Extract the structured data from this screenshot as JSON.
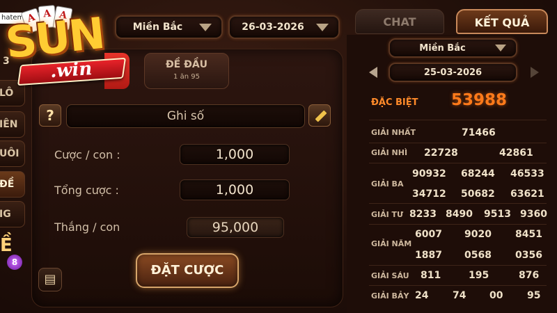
{
  "header": {
    "region_select": "Miền Bắc",
    "date_select": "26-03-2026",
    "username": "hatemdian"
  },
  "left_tabs": [
    "LÔ",
    "IÊN",
    "UÔI",
    "ĐỀ",
    "IG"
  ],
  "left_numeral": "3",
  "left_badge": "8",
  "logo": {
    "brand": "SUN",
    "sub": ".win",
    "cards": [
      "A",
      "A",
      "A"
    ]
  },
  "bet_panel": {
    "tab_title": "ĐỀ ĐẦU",
    "tab_subtitle": "1 ăn 95",
    "help_label": "?",
    "number_placeholder": "Ghi số",
    "rows": [
      {
        "label": "Cược / con :",
        "value": "1,000"
      },
      {
        "label": "Tổng cược :",
        "value": "1,000"
      },
      {
        "label": "Thắng / con",
        "value": "95,000"
      }
    ],
    "bet_button": "ĐẶT CƯỢC"
  },
  "results": {
    "tabs": {
      "chat": "CHAT",
      "result": "KẾT QUẢ"
    },
    "region": "Miền Bắc",
    "date": "25-03-2026",
    "special": {
      "label": "ĐẶC BIỆT",
      "value": "53988"
    },
    "prizes": [
      {
        "label": "GIẢI NHẤT",
        "numbers": [
          "71466"
        ]
      },
      {
        "label": "GIẢI NHÌ",
        "numbers": [
          "22728",
          "42861"
        ]
      },
      {
        "label": "GIẢI BA",
        "numbers": [
          "90932",
          "68244",
          "46533",
          "34712",
          "50682",
          "63621"
        ]
      },
      {
        "label": "GIẢI TƯ",
        "numbers": [
          "8233",
          "8490",
          "9513",
          "9360"
        ]
      },
      {
        "label": "GIẢI NĂM",
        "numbers": [
          "6007",
          "9020",
          "8451",
          "1887",
          "0568",
          "0356"
        ]
      },
      {
        "label": "GIẢI SÁU",
        "numbers": [
          "811",
          "195",
          "876"
        ]
      },
      {
        "label": "GIẢI BẢY",
        "numbers": [
          "24",
          "74",
          "00",
          "95"
        ]
      }
    ]
  },
  "colors": {
    "accent_orange": "#ff7a1a",
    "panel_dark": "#1e0d08",
    "gold": "#ffcc33",
    "logo_red": "#e8232a"
  },
  "icons": [
    "help-icon",
    "pencil-icon",
    "scroll-icon",
    "caret-down-icon",
    "arrow-left-icon",
    "arrow-right-icon"
  ]
}
